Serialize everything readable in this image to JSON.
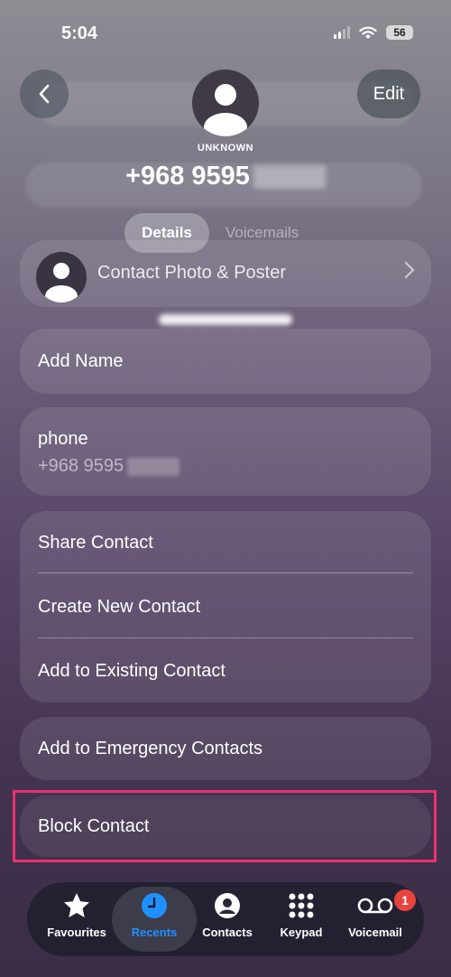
{
  "status": {
    "time": "5:04",
    "battery": "56"
  },
  "header": {
    "edit_label": "Edit",
    "caller_label": "UNKNOWN",
    "number": "+968 9595"
  },
  "segments": {
    "details": "Details",
    "voicemails": "Voicemails"
  },
  "photo_row": {
    "label": "Contact Photo & Poster"
  },
  "add_name": {
    "label": "Add Name"
  },
  "phone": {
    "label": "phone",
    "number": "+968 9595"
  },
  "actions": {
    "share": "Share Contact",
    "create": "Create New Contact",
    "add_existing": "Add to Existing Contact"
  },
  "emergency": {
    "label": "Add to Emergency Contacts"
  },
  "block": {
    "label": "Block Contact"
  },
  "highlight_color": "#e8336f",
  "tabs": [
    {
      "label": "Favourites",
      "icon": "star-icon"
    },
    {
      "label": "Recents",
      "icon": "clock-icon",
      "active": true
    },
    {
      "label": "Contacts",
      "icon": "person-circle-icon"
    },
    {
      "label": "Keypad",
      "icon": "keypad-icon"
    },
    {
      "label": "Voicemail",
      "icon": "voicemail-icon",
      "badge": "1"
    }
  ],
  "accent_color": "#1e90ff"
}
